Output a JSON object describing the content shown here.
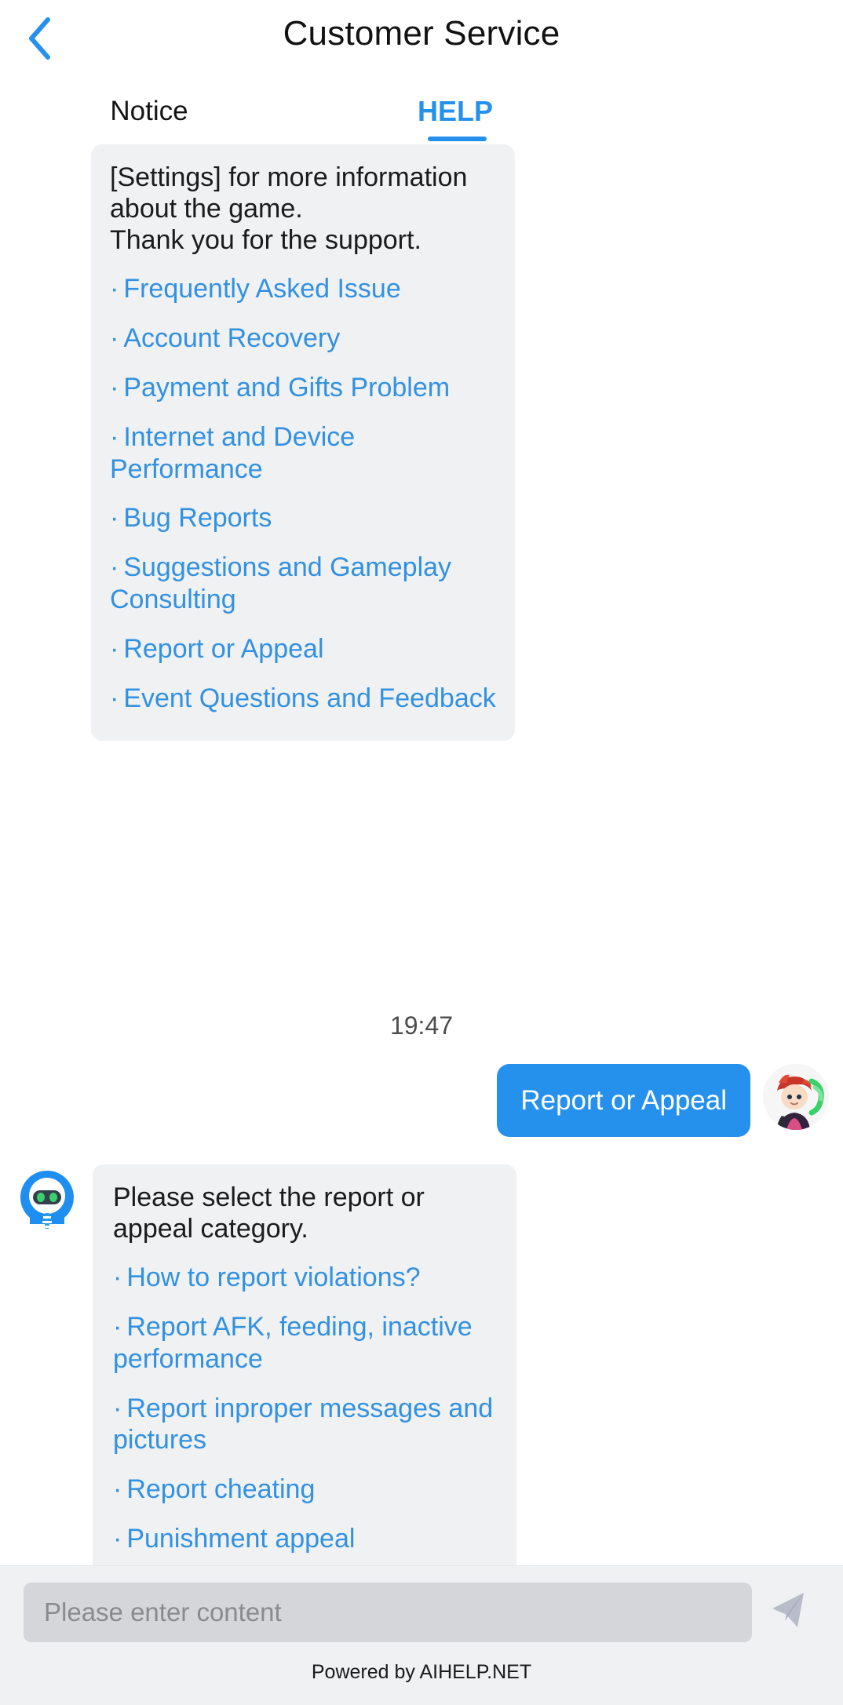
{
  "header": {
    "title": "Customer Service",
    "back_icon": "chevron-left-icon"
  },
  "tabs": [
    {
      "label": "Notice",
      "active": false
    },
    {
      "label": "HELP",
      "active": true
    }
  ],
  "colors": {
    "accent": "#2691ec",
    "link": "#3291e0",
    "bubble_bg": "#f0f1f3",
    "user_bubble_bg": "#2691ec",
    "input_bg": "#d5d6da",
    "bar_bg": "#f0f1f3"
  },
  "chat": {
    "bot_message_1": {
      "sender": "bot",
      "text_lines": [
        "[Settings] for more information about the game.",
        "Thank you for the support."
      ],
      "links": [
        "Frequently Asked Issue",
        "Account Recovery",
        "Payment and Gifts Problem",
        "Internet and Device Performance",
        "Bug Reports",
        "Suggestions and Gameplay Consulting",
        "Report or Appeal",
        "Event Questions and Feedback"
      ]
    },
    "timestamp": "19:47",
    "user_message": {
      "sender": "user",
      "text": "Report or Appeal",
      "avatar_icon": "user-avatar"
    },
    "bot_message_2": {
      "sender": "bot",
      "avatar_icon": "robot-avatar",
      "text": "Please select the report or appeal category.",
      "links": [
        "How to report violations?",
        "Report AFK, feeding, inactive performance",
        "Report inproper messages and pictures",
        "Report cheating",
        "Punishment appeal"
      ]
    }
  },
  "composer": {
    "placeholder": "Please enter content",
    "value": "",
    "send_icon": "send-paper-plane-icon"
  },
  "footer": {
    "text": "Powered by AIHELP.NET"
  },
  "bullet": "·"
}
